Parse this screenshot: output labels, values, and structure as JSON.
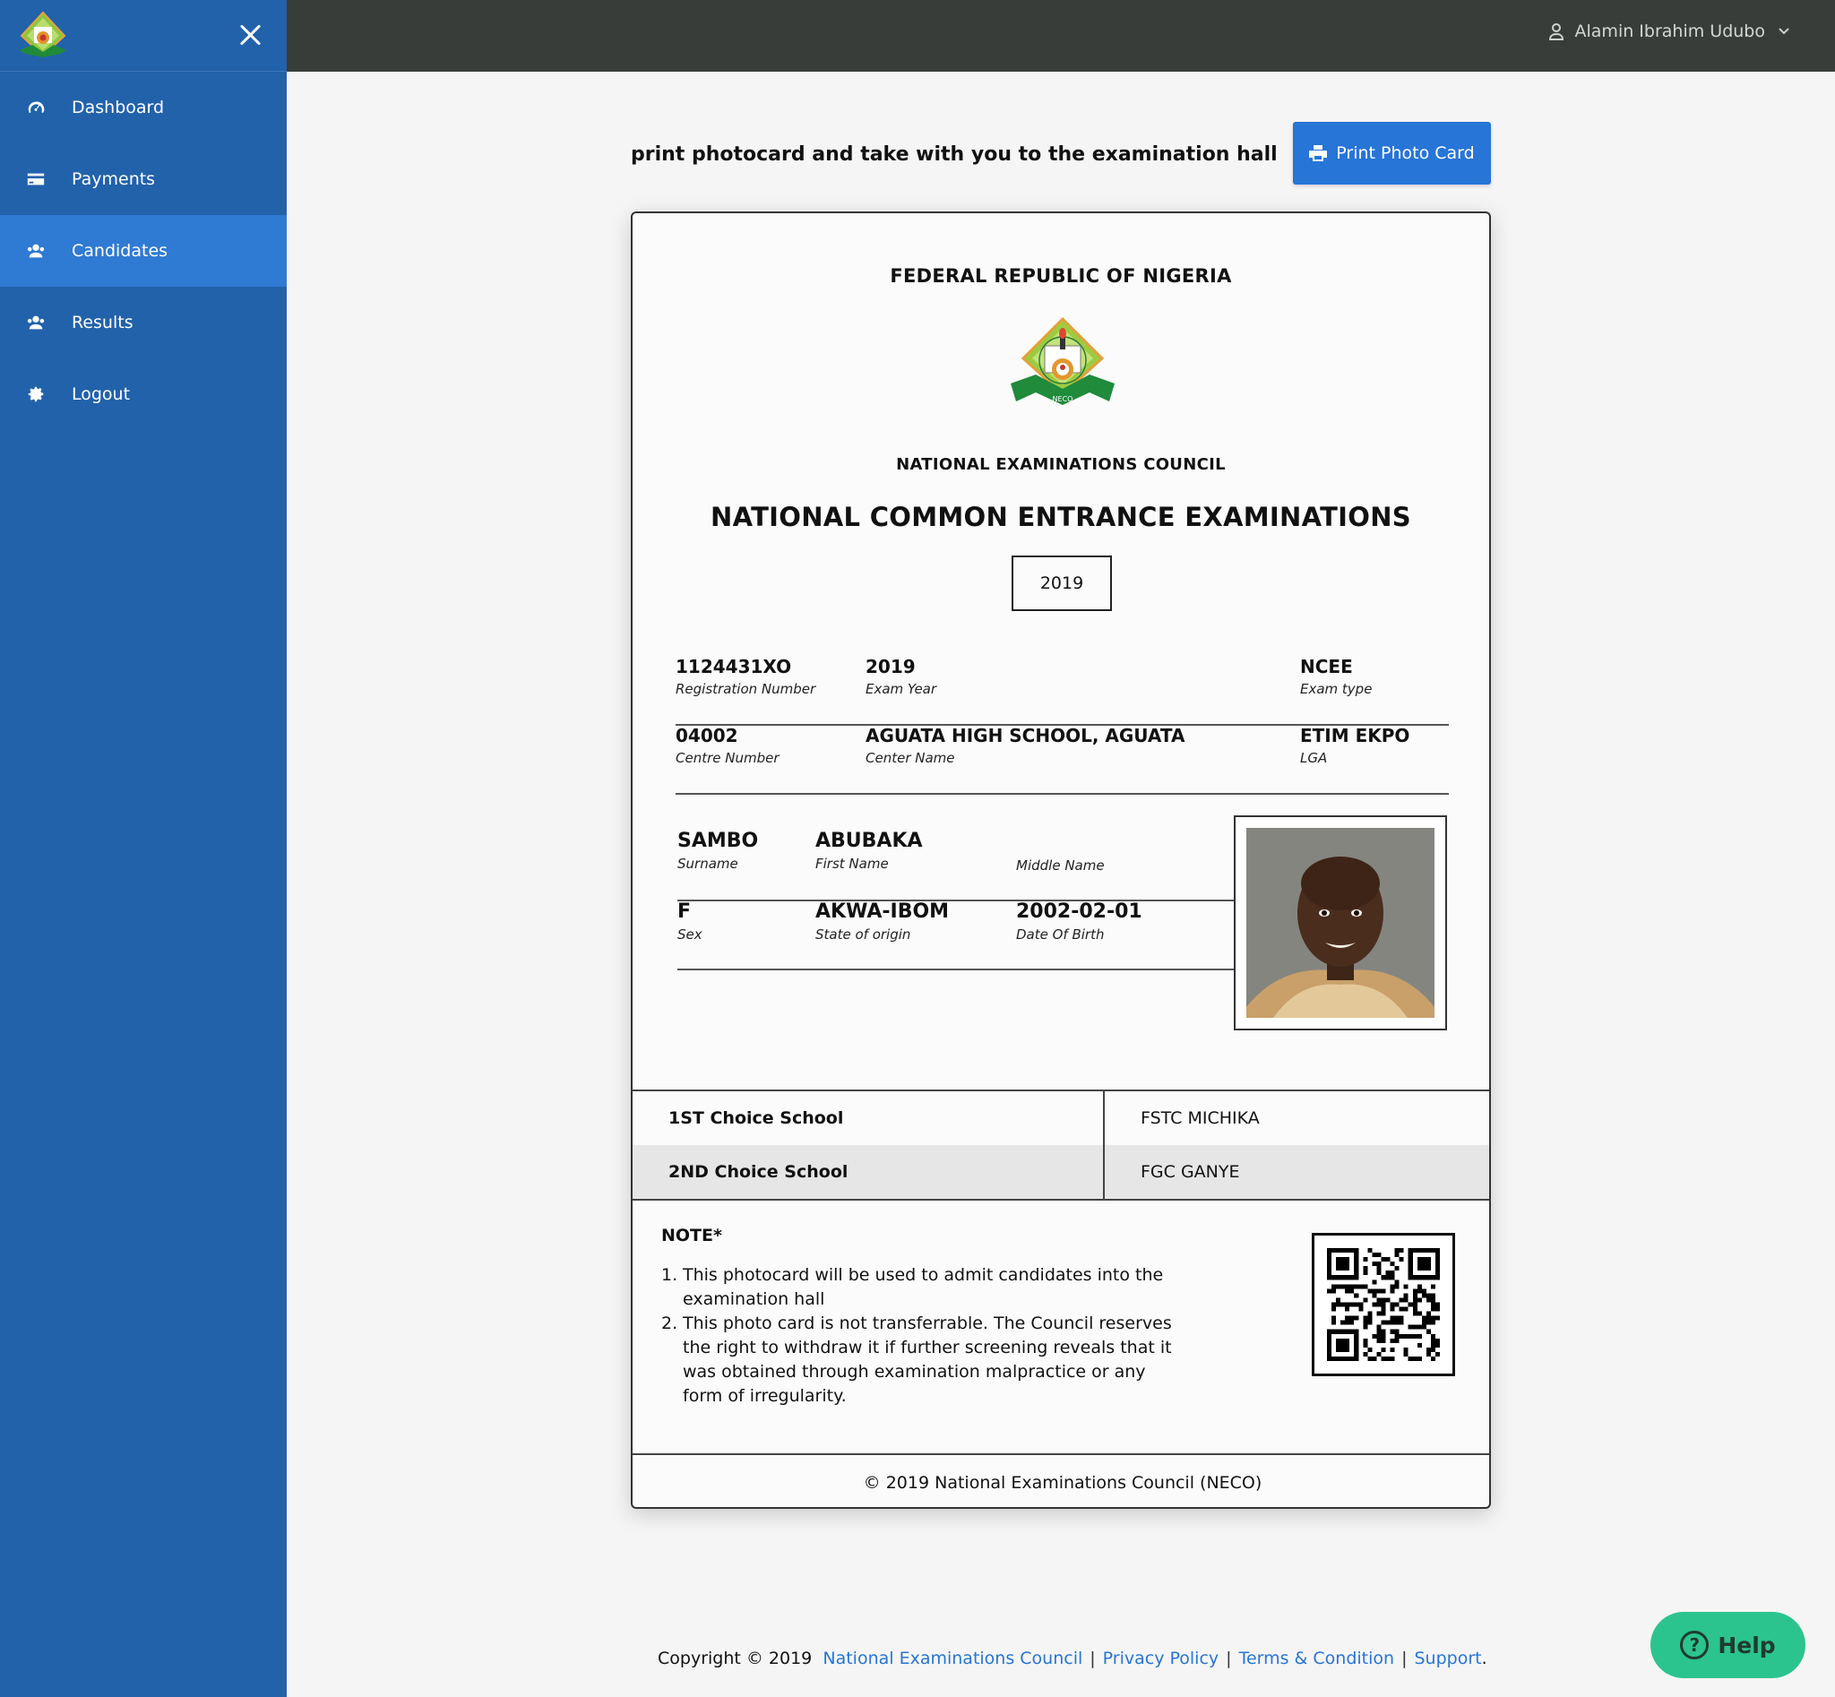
{
  "sidebar": {
    "items": [
      {
        "label": "Dashboard",
        "icon": "dashboard-gauge-icon"
      },
      {
        "label": "Payments",
        "icon": "credit-card-icon"
      },
      {
        "label": "Candidates",
        "icon": "users-icon",
        "active": true
      },
      {
        "label": "Results",
        "icon": "users-icon"
      },
      {
        "label": "Logout",
        "icon": "gear-icon"
      }
    ]
  },
  "topbar": {
    "user_name": "Alamin Ibrahim Udubo"
  },
  "main": {
    "instruction": "print photocard and take with you to the examination hall",
    "print_button": "Print Photo Card"
  },
  "card": {
    "country": "FEDERAL REPUBLIC OF NIGERIA",
    "crest_text": "NECO",
    "council": "NATIONAL EXAMINATIONS COUNCIL",
    "exam_title": "NATIONAL COMMON ENTRANCE EXAMINATIONS",
    "year": "2019",
    "registration_number": {
      "value": "1124431XO",
      "label": "Registration Number"
    },
    "exam_year": {
      "value": "2019",
      "label": "Exam Year"
    },
    "exam_type": {
      "value": "NCEE",
      "label": "Exam type"
    },
    "centre_number": {
      "value": "04002",
      "label": "Centre Number"
    },
    "center_name": {
      "value": "AGUATA HIGH SCHOOL, AGUATA",
      "label": "Center Name"
    },
    "lga": {
      "value": "ETIM EKPO",
      "label": "LGA"
    },
    "surname": {
      "value": "SAMBO",
      "label": "Surname"
    },
    "first_name": {
      "value": "ABUBAKA",
      "label": "First Name"
    },
    "middle_name": {
      "value": "",
      "label": "Middle Name"
    },
    "sex": {
      "value": "F",
      "label": "Sex"
    },
    "state_of_origin": {
      "value": "AKWA-IBOM",
      "label": "State of origin"
    },
    "date_of_birth": {
      "value": "2002-02-01",
      "label": "Date Of Birth"
    },
    "choices": [
      {
        "label": "1ST Choice School",
        "value": "FSTC MICHIKA"
      },
      {
        "label": "2ND Choice School",
        "value": "FGC GANYE"
      }
    ],
    "note_title": "NOTE*",
    "notes": [
      {
        "num": "1.",
        "text": "This photocard will be used to admit candidates into the examination hall"
      },
      {
        "num": "2.",
        "text": "This photo card is not transferrable. The Council reserves the right to withdraw it if further screening reveals that it was obtained through examination malpractice or any form of irregularity."
      }
    ],
    "footer": "© 2019 National Examinations Council (NECO)"
  },
  "footer": {
    "copyright": "Copyright © 2019",
    "links": [
      "National Examinations Council",
      "Privacy Policy",
      "Terms & Condition",
      "Support"
    ],
    "trailing": "."
  },
  "help": {
    "label": "Help"
  },
  "colors": {
    "sidebar": "#2162ab",
    "sidebar_active": "#2f7ad2",
    "topbar": "#383d3a",
    "primary": "#2775d6",
    "help": "#2bc48f"
  }
}
